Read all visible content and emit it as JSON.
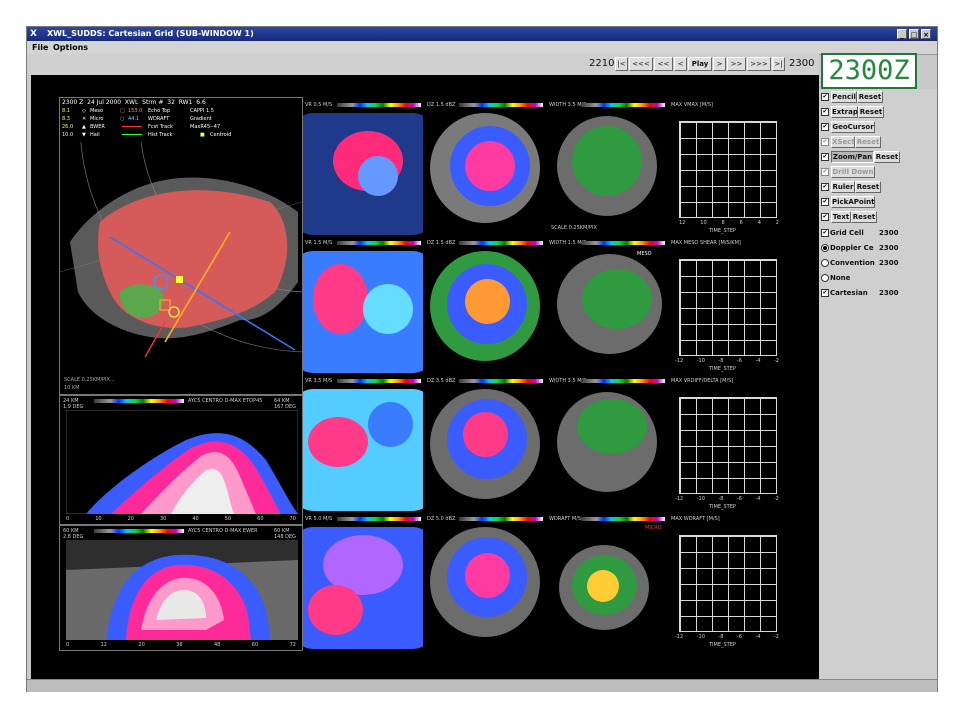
{
  "window": {
    "title": "XWL_SUDDS: Cartesian Grid (SUB-WINDOW 1)",
    "title_icon": "X",
    "controls": [
      "_",
      "□",
      "×"
    ]
  },
  "menu": [
    "File",
    "Options"
  ],
  "nav": {
    "start_time": "2210",
    "buttons": [
      "|<",
      "<<<",
      "<<",
      "<",
      "Play",
      ">",
      ">>",
      ">>>",
      ">|"
    ],
    "end_time": "2300",
    "big_time": "2300Z"
  },
  "main_panel": {
    "header_line1": [
      "2300 Z",
      "24 Jul 2000",
      "XWL",
      "Strm #",
      "32",
      "RW1",
      "6.6"
    ],
    "legend": {
      "meso": {
        "value": "8.1",
        "label": "Meso"
      },
      "micro": {
        "value": "8.3",
        "label": "Micro"
      },
      "bwer": {
        "value": "26.0",
        "label": "BWER"
      },
      "hail": {
        "value": "10.0",
        "label": "Hail"
      },
      "echo_top": {
        "value": "153.0",
        "label": "Echo Top"
      },
      "wdraft": {
        "value": "44.1",
        "label": "WDRAFT"
      },
      "fcst_track": "Fcst Track",
      "hist_track": "Hist Track",
      "cappi": "CAPPI 1.5",
      "gradient": "Gradient",
      "maxr": "MaxR45--47",
      "centroid": "Centroid"
    },
    "scale": "SCALE 0.25KM/PIX...",
    "scale_km": "10 KM"
  },
  "cross_sections": [
    {
      "left_km": "24 KM",
      "deg": "1.9 DEG",
      "title": "AYC5  CENTRO D-MAX ETOP45",
      "right_km": "64 KM",
      "right_deg": "167 DEG",
      "axis": [
        "0",
        "10",
        "20",
        "30",
        "40",
        "50",
        "60",
        "70"
      ]
    },
    {
      "left_km": "60 KM",
      "deg": "2.8 DEG",
      "title": "AYC5  CENTRO D-MAX EWER",
      "right_km": "60 KM",
      "right_deg": "148 DEG",
      "axis": [
        "0",
        "12",
        "20",
        "36",
        "48",
        "60",
        "72"
      ]
    }
  ],
  "rows": [
    {
      "labels": [
        "VR 0.5 M/S",
        "DZ 1.5 dBZ",
        "WIDTH 3.5 M/S",
        "MAX VMAX [M/S]"
      ],
      "time_label": "TIME_STEP",
      "note": "SCALE 0.25KM/PIX"
    },
    {
      "labels": [
        "VR 1.5 M/S",
        "DZ 1.5 dBZ",
        "WIDTH 1.5 M/S",
        "MAX MESO SHEAR [M/S/KM]"
      ],
      "time_label": "TIME_STEP",
      "note": "MESO"
    },
    {
      "labels": [
        "VR 3.5 M/S",
        "DZ 3.5 dBZ",
        "WIDTH 3.5 M/S",
        "MAX VRDIFF/DELTA [M/S]"
      ],
      "time_label": "TIME_STEP",
      "note": ""
    },
    {
      "labels": [
        "VR 5.0 M/S",
        "DZ 5.0 dBZ",
        "WDRAFT M/S",
        "MAX WDRAFT [M/S]"
      ],
      "time_label": "TIME_STEP",
      "note": "MICRO"
    }
  ],
  "grid_axis": [
    "-12",
    "-10",
    "-8",
    "-6",
    "-4",
    "-2"
  ],
  "grid_axis_first": [
    "12",
    "10",
    "8",
    "6",
    "4",
    "2"
  ],
  "sidebar": {
    "tools": [
      {
        "label": "Pencil",
        "reset": "Reset",
        "checked": true,
        "enabled": true
      },
      {
        "label": "Extrap",
        "reset": "Reset",
        "checked": true,
        "enabled": true
      },
      {
        "label": "GeoCursor",
        "reset": "",
        "checked": true,
        "enabled": true
      },
      {
        "label": "XSect",
        "reset": "Reset",
        "checked": true,
        "enabled": false
      },
      {
        "label": "Zoom/Pan",
        "reset": "Reset",
        "checked": true,
        "enabled": true
      },
      {
        "label": "Drill Down",
        "reset": "",
        "checked": true,
        "enabled": false
      },
      {
        "label": "Ruler",
        "reset": "Reset",
        "checked": true,
        "enabled": true
      },
      {
        "label": "PickAPoint",
        "reset": "",
        "checked": true,
        "enabled": true
      },
      {
        "label": "Text",
        "reset": "Reset",
        "checked": true,
        "enabled": true
      }
    ],
    "layers": [
      {
        "label": "Grid Cell",
        "value": "2300",
        "kind": "check",
        "on": true
      },
      {
        "label": "Doppler Ce",
        "value": "2300",
        "kind": "radio",
        "on": true
      },
      {
        "label": "Convention",
        "value": "2300",
        "kind": "radio",
        "on": false
      },
      {
        "label": "None",
        "value": "",
        "kind": "radio",
        "on": false
      },
      {
        "label": "Cartesian",
        "value": "2300",
        "kind": "check",
        "on": true
      }
    ]
  }
}
